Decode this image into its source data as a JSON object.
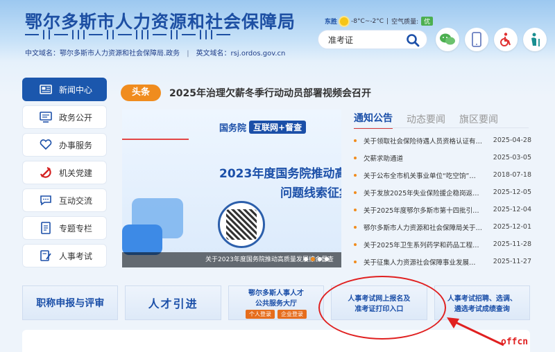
{
  "header": {
    "title": "鄂尔多斯市人力资源和社会保障局",
    "cn_domain": "中文域名：鄂尔多斯市人力资源和社会保障局.政务",
    "sep": "|",
    "en_domain": "英文域名：rsj.ordos.gov.cn",
    "weather_city": "东胜",
    "weather_temp": "-8°C~-2°C",
    "weather_sep": "|",
    "quality_label": "空气质量:",
    "quality_value": "优",
    "search_value": "准考证"
  },
  "sidebar": {
    "items": [
      {
        "label": "新闻中心",
        "icon": "newspaper-icon"
      },
      {
        "label": "政务公开",
        "icon": "monitor-icon"
      },
      {
        "label": "办事服务",
        "icon": "heart-hand-icon"
      },
      {
        "label": "机关党建",
        "icon": "party-emblem-icon"
      },
      {
        "label": "互动交流",
        "icon": "chat-icon"
      },
      {
        "label": "专题专栏",
        "icon": "document-icon"
      },
      {
        "label": "人事考试",
        "icon": "exam-icon"
      }
    ]
  },
  "headline": {
    "badge": "头条",
    "text": "2025年治理欠薪冬季行动动员部署视频会召开"
  },
  "slider": {
    "org": "国务院",
    "tag": "互联网+督查",
    "line1": "2023年度国务院推动高质量",
    "line2": "问题线索征集",
    "caption": "关于2023年度国务院推动高质量发展综合督查"
  },
  "news": {
    "tabs": [
      "通知公告",
      "动态要闻",
      "旗区要闻"
    ],
    "items": [
      {
        "title": "关于领取社会保险待遇人员资格认证有…",
        "date": "2025-04-28"
      },
      {
        "title": "欠薪求助通道",
        "date": "2025-03-05"
      },
      {
        "title": "关于公布全市机关事业单位“吃空饷”…",
        "date": "2018-07-18"
      },
      {
        "title": "关于发放2025年失业保险援企稳岗返…",
        "date": "2025-12-05"
      },
      {
        "title": "关于2025年度鄂尔多斯市第十四批引…",
        "date": "2025-12-04"
      },
      {
        "title": "鄂尔多斯市人力资源和社会保障局关于…",
        "date": "2025-12-01"
      },
      {
        "title": "关于2025年卫生系列药学和药品工程…",
        "date": "2025-11-28"
      },
      {
        "title": "关于征集人力资源社会保障事业发展…",
        "date": "2025-11-27"
      }
    ]
  },
  "banners": {
    "b1": "职称申报与评审",
    "b2": "人才引进",
    "b3_line1": "鄂尔多斯人事人才",
    "b3_line2": "公共服务大厅",
    "b3_personal": "个人登录",
    "b3_company": "企业登录",
    "b4_line1": "人事考试网上报名及",
    "b4_line2": "准考证打印入口",
    "b5_line1": "人事考试招聘、选调、",
    "b5_line2": "遴选考试成绩查询"
  },
  "watermark": "offcn",
  "colors": {
    "primary": "#1b57ad",
    "accent": "#f08c1e",
    "annotation": "#e02020"
  }
}
